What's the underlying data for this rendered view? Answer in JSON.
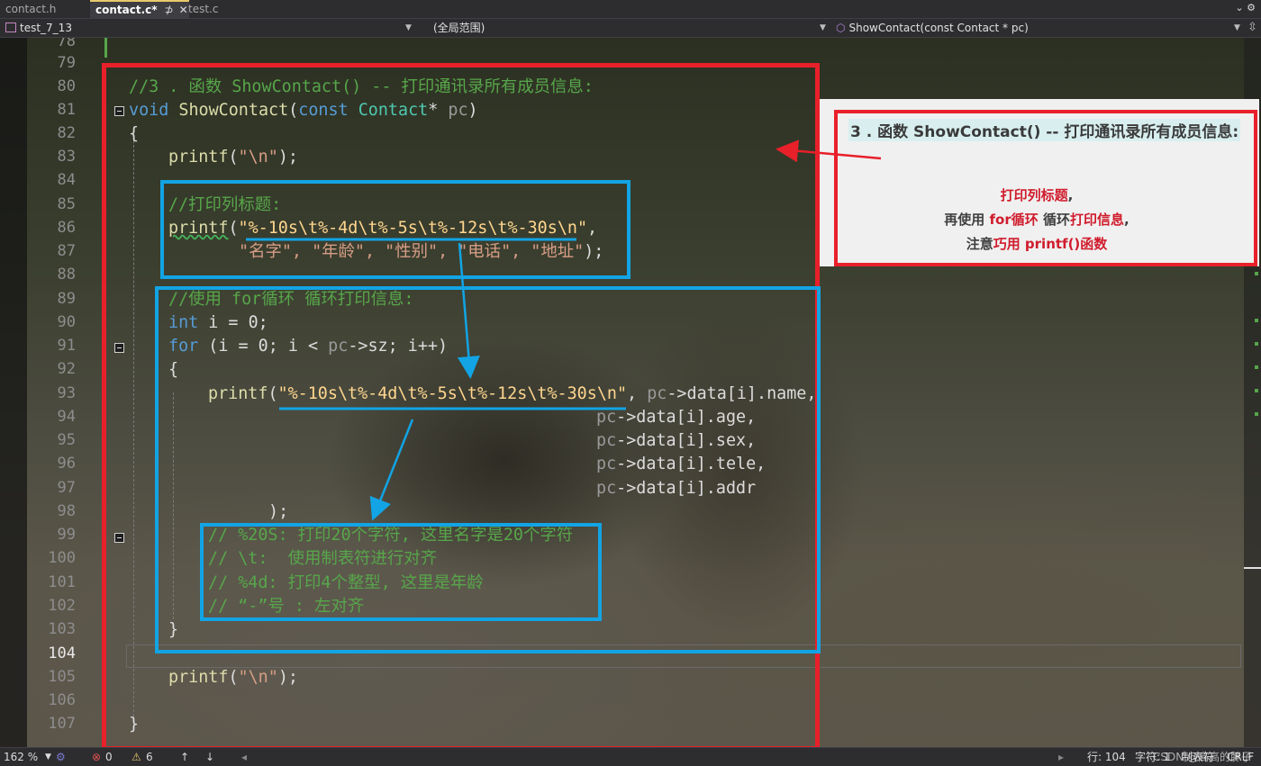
{
  "tabs": [
    {
      "label": "contact.h"
    },
    {
      "label": "contact.c*",
      "pin": "⊅",
      "close": "✕"
    },
    {
      "label": "test.c"
    }
  ],
  "tabbar_right": "⌄ ⚙",
  "nav": {
    "project": "test_7_13",
    "scope": "(全局范围)",
    "function": "ShowContact(const Contact * pc)"
  },
  "line_numbers": [
    "78",
    "79",
    "80",
    "81",
    "82",
    "83",
    "84",
    "85",
    "86",
    "87",
    "88",
    "89",
    "90",
    "91",
    "92",
    "93",
    "94",
    "95",
    "96",
    "97",
    "98",
    "99",
    "100",
    "101",
    "102",
    "103",
    "104",
    "105",
    "106",
    "107"
  ],
  "code": {
    "l80": "//3 . 函数 ShowContact() -- 打印通讯录所有成员信息:",
    "l81_kw": "void",
    "l81_fn": "ShowContact",
    "l81_const": "const",
    "l81_type": "Contact",
    "l81_star": "*",
    "l81_param": "pc",
    "l82": "{",
    "l83_fn": "printf",
    "l83_str": "\"\\n\"",
    "l83_end": ");",
    "l85": "//打印列标题:",
    "l86_fn": "printf",
    "l86_str": "\"%-10s\\t%-4d\\t%-5s\\t%-12s\\t%-30s\\n\"",
    "l86_end": ",",
    "l87": "\"名字\", \"年龄\", \"性别\", \"电话\", \"地址\"",
    "l87_end": ");",
    "l89": "//使用 for循环 循环打印信息:",
    "l90_kw": "int",
    "l90_rest": " i = 0;",
    "l91_kw": "for",
    "l91_rest": " (i = 0; i < ",
    "l91_pc": "pc",
    "l91_rest2": "->sz; i++)",
    "l92": "{",
    "l93_fn": "printf",
    "l93_str": "\"%-10s\\t%-4d\\t%-5s\\t%-12s\\t%-30s\\n\"",
    "l93_rest": ", ",
    "l93_pc": "pc",
    "l93_tail": "->data[i].name,",
    "l94_pc": "pc",
    "l94_tail": "->data[i].age,",
    "l95_pc": "pc",
    "l95_tail": "->data[i].sex,",
    "l96_pc": "pc",
    "l96_tail": "->data[i].tele,",
    "l97_pc": "pc",
    "l97_tail": "->data[i].addr",
    "l98": ");",
    "l99": "// %20S: 打印20个字符, 这里名字是20个字符",
    "l100": "// \\t:  使用制表符进行对齐",
    "l101": "// %4d: 打印4个整型, 这里是年龄",
    "l102": "// “-”号 : 左对齐",
    "l103": "}",
    "l105_fn": "printf",
    "l105_str": "\"\\n\"",
    "l105_end": ");",
    "l107": "}"
  },
  "callout": {
    "title": "3 . 函数 ShowContact() -- 打印通讯录所有成员信息:",
    "line1_red": "打印列标题",
    "line1_tail": ",",
    "line2_a": "再使用 ",
    "line2_red1": "for循环",
    "line2_b": " 循环",
    "line2_red2": "打印信息",
    "line2_tail": ",",
    "line3_a": "注意",
    "line3_red": "巧用 printf()函数"
  },
  "status": {
    "zoom": "162 %",
    "errors": "0",
    "warnings": "6",
    "row": "行: 104",
    "col": "字符: 1",
    "tabs": "制表符",
    "eol": "CRLF",
    "watermark": "CSDN @高高的胖子"
  },
  "colors": {
    "annotation_red": "#e8202a",
    "annotation_blue": "#12a4e4",
    "comment_green": "#57a64a",
    "keyword_blue": "#569cd6"
  }
}
